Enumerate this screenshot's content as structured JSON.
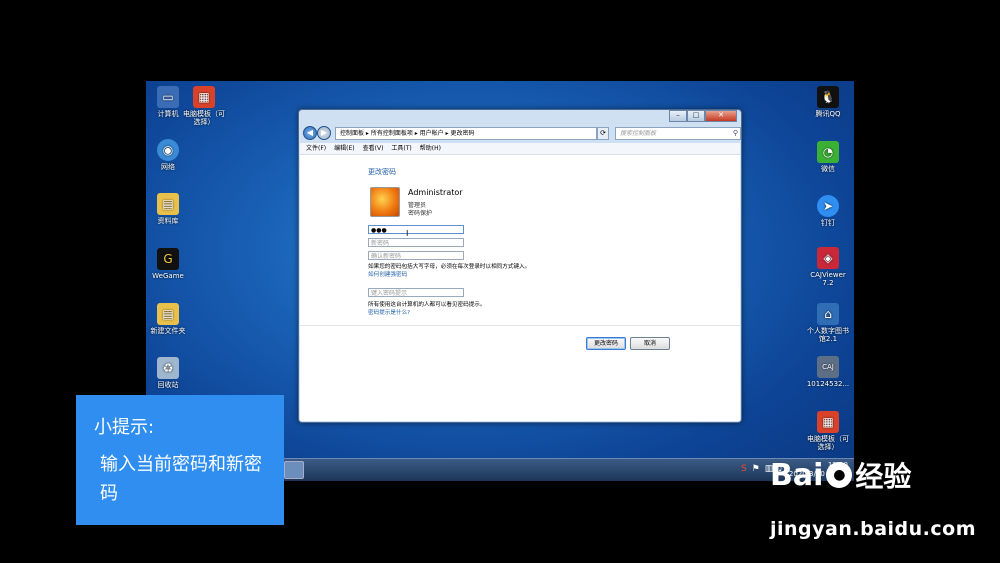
{
  "desktop": {
    "left_icons": [
      {
        "label": "计算机",
        "icon": "computer-icon",
        "color": "#3a6db5"
      },
      {
        "label": "电脑模板（可选择）",
        "icon": "winrar-icon",
        "color": "#d9422a"
      },
      {
        "label": "网络",
        "icon": "network-icon",
        "color": "#3a8ad6"
      },
      {
        "label": "资料库",
        "icon": "folder-icon",
        "color": "#e8c04a"
      },
      {
        "label": "WeGame",
        "icon": "wegame-icon",
        "color": "#111111"
      },
      {
        "label": "新建文件夹",
        "icon": "folder-icon",
        "color": "#e8c04a"
      },
      {
        "label": "回收站",
        "icon": "recycle-bin-icon",
        "color": "#9fb6cf"
      }
    ],
    "right_icons": [
      {
        "label": "腾讯QQ",
        "icon": "qq-icon",
        "color": "#111111"
      },
      {
        "label": "微信",
        "icon": "wechat-icon",
        "color": "#3cb034"
      },
      {
        "label": "钉钉",
        "icon": "dingtalk-icon",
        "color": "#2f8ef0"
      },
      {
        "label": "CAJViewer 7.2",
        "icon": "cajviewer-icon",
        "color": "#c9283b"
      },
      {
        "label": "个人数字图书馆2.1",
        "icon": "library-icon",
        "color": "#2f6db5"
      },
      {
        "label": "10124532...",
        "icon": "caj-file-icon",
        "color": "#5d6f86"
      },
      {
        "label": "电脑模板（可选择）",
        "icon": "winrar-icon",
        "color": "#d9422a"
      }
    ]
  },
  "taskbar": {
    "time": "12:10",
    "date": "2020/3/10 星期二"
  },
  "window": {
    "address": "控制面板  ▸  所有控制面板项  ▸  用户帐户  ▸  更改密码",
    "search_placeholder": "搜索控制面板",
    "menu": [
      "文件(F)",
      "编辑(E)",
      "查看(V)",
      "工具(T)",
      "帮助(H)"
    ],
    "heading": "更改密码",
    "user": {
      "name": "Administrator",
      "role": "管理员",
      "protection": "密码保护"
    },
    "current_password_value": "●●●",
    "new_password_placeholder": "新密码",
    "confirm_password_placeholder": "确认新密码",
    "caps_note": "如果您的密码包括大写字母，必须在每次登录时以相同方式键入。",
    "strong_password_link": "如何创建强密码",
    "hint_placeholder": "键入密码提示",
    "hint_note": "所有使用这台计算机的人都可以看见密码提示。",
    "hint_link": "密码提示是什么?",
    "change_button": "更改密码",
    "cancel_button": "取消"
  },
  "tip": {
    "title": "小提示:",
    "body": "输入当前密码和新密码"
  },
  "watermark": {
    "brand_left": "Bai",
    "brand_right": "经验",
    "url": "jingyan.baidu.com"
  }
}
